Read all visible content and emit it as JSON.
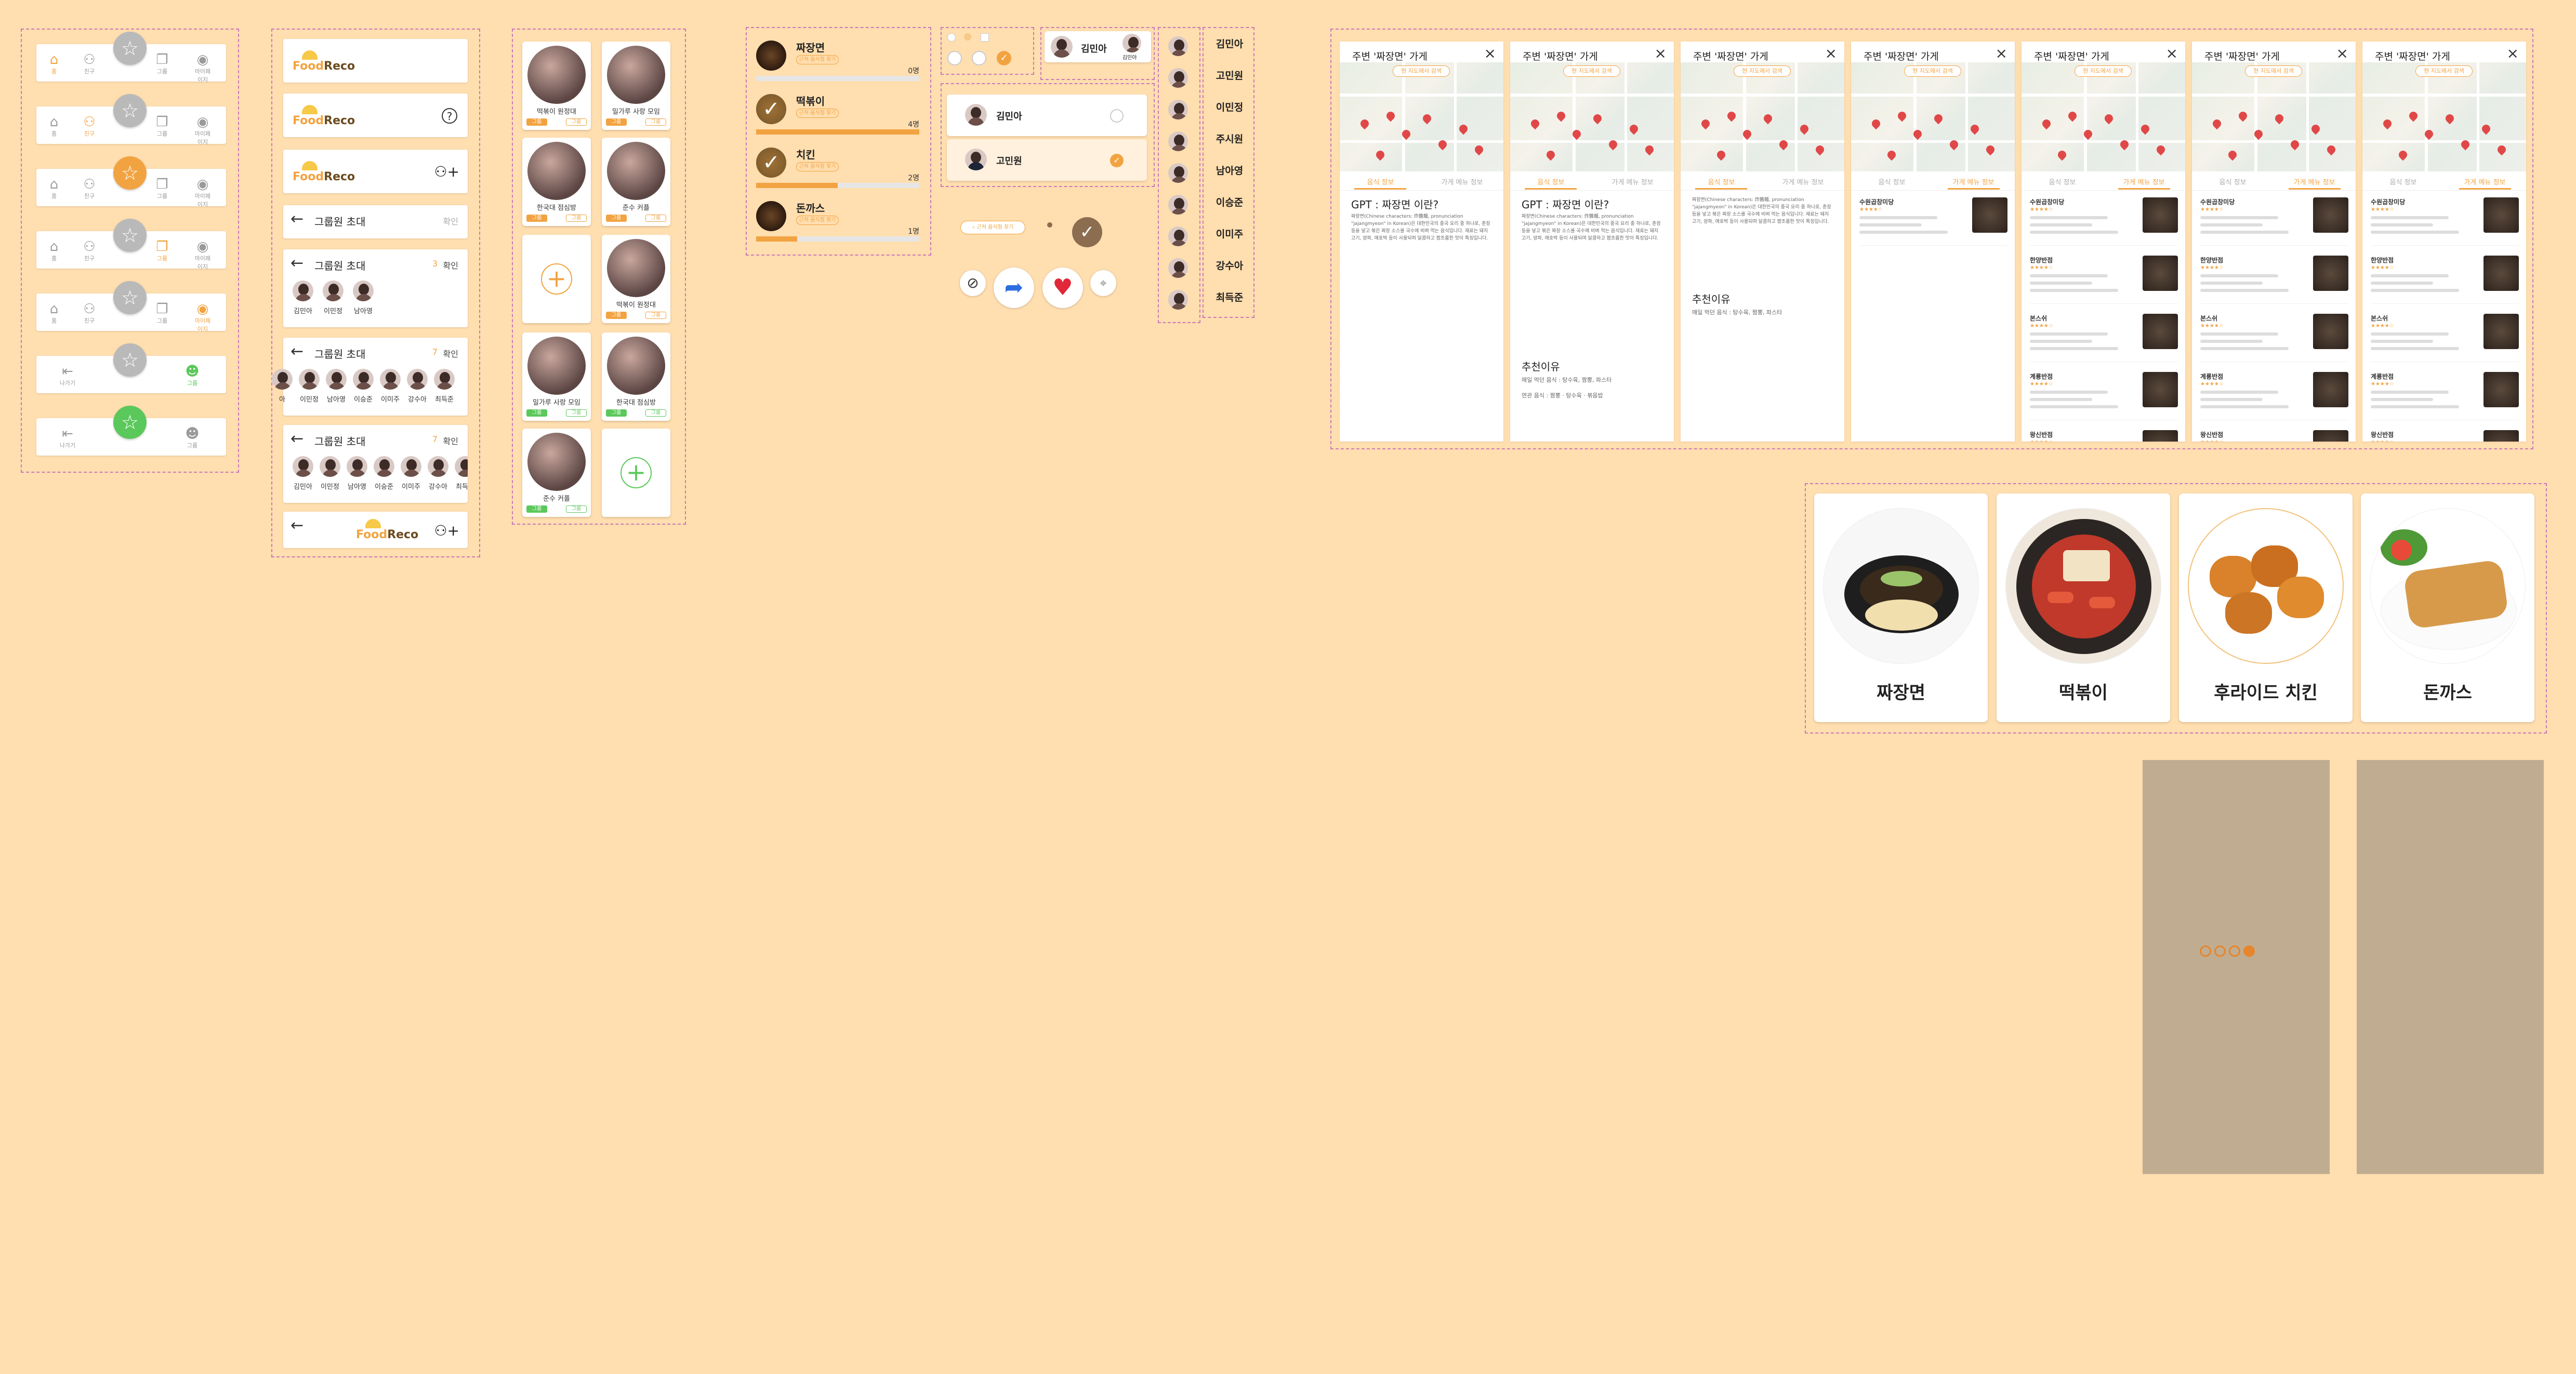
{
  "nav": {
    "home": "홈",
    "friends": "친구",
    "recommend": "추천",
    "group": "그룹",
    "mypage": "마이페이지",
    "logout": "나가기"
  },
  "logo": {
    "food": "Food",
    "reco": "Reco"
  },
  "invite": {
    "title": "그룹원 초대",
    "confirm": "확인",
    "count3": "3",
    "count7": "7"
  },
  "members3": [
    "김민아",
    "이민정",
    "남아영"
  ],
  "members7": [
    "김민아",
    "이민정",
    "남아영",
    "이승준",
    "이미주",
    "강수아",
    "최득준"
  ],
  "members7b": [
    "아",
    "이민정",
    "남아영",
    "이승준",
    "이미주",
    "강수아",
    "최득준"
  ],
  "groups": [
    {
      "name": "떡볶이 원정대",
      "t1": "그룹",
      "t2": "그룹"
    },
    {
      "name": "밀가루 사랑 모임",
      "t1": "그룹",
      "t2": "그룹"
    },
    {
      "name": "한국대 점심방",
      "t1": "그룹",
      "t2": "그룹"
    },
    {
      "name": "준수 커플",
      "t1": "그룹",
      "t2": "그룹"
    },
    {
      "name": "떡볶이 원정대",
      "t1": "그룹",
      "t2": "그룹"
    },
    {
      "name": "밀가루 사랑 모임",
      "t1": "그룹",
      "t2": "그룹"
    },
    {
      "name": "한국대 점심방",
      "t1": "그룹",
      "t2": "그룹"
    },
    {
      "name": "준수 커플",
      "t1": "그룹",
      "t2": "그룹"
    }
  ],
  "votes": [
    {
      "name": "짜장면",
      "sub": "근처 음식점 찾기",
      "count": "0명",
      "pct": 0
    },
    {
      "name": "떡볶이",
      "sub": "근처 음식점 찾기",
      "count": "4명",
      "pct": 1.0
    },
    {
      "name": "치킨",
      "sub": "근처 음식점 찾기",
      "count": "2명",
      "pct": 0.5
    },
    {
      "name": "돈까스",
      "sub": "근처 음식점 찾기",
      "count": "1명",
      "pct": 0.25
    }
  ],
  "select": {
    "user1": "김민아",
    "user2": "고민원",
    "chat_name": "김민아",
    "chat_sub": "김민아",
    "search": "근처 음식점 찾기"
  },
  "names": [
    "김민아",
    "고민원",
    "이민정",
    "주시원",
    "남아영",
    "이승준",
    "이미주",
    "강수아",
    "최득준"
  ],
  "screen": {
    "title": "주변 '짜장면' 가게",
    "pill": "현 지도에서 검색",
    "tab1": "음식 정보",
    "tab2": "가게 메뉴 정보",
    "gpt": "GPT : 짜장면 이란?",
    "body": "짜장면(Chinese characters: 炸醬麵, pronunciation \"jajangmyeon\" in Korean)은 대한민국의 중국 요리 중 하나로, 춘장 등을 넣고 볶은 짜장 소스를 국수에 비벼 먹는 음식입니다. 재료는 돼지고기, 양파, 애호박 등이 사용되며 달콤하고 짭조름한 맛이 특징입니다.",
    "rec": "추천이유",
    "reason": "매일 먹던 음식 : 탕수육, 짬뽕, 파스타",
    "reason2": "연관 음식 : 짬뽕 · 탕수육 · 볶음밥",
    "stores": [
      "수원곱창미당",
      "한양반점",
      "본스쉬",
      "계룡반점",
      "왕신반점"
    ]
  },
  "foods": [
    "짜장면",
    "떡볶이",
    "후라이드 치킨",
    "돈까스"
  ],
  "colors": {
    "accent": "#F2A341",
    "green": "#5BC85B",
    "bg": "#FFDEAF",
    "panel": "#C0AD91"
  }
}
